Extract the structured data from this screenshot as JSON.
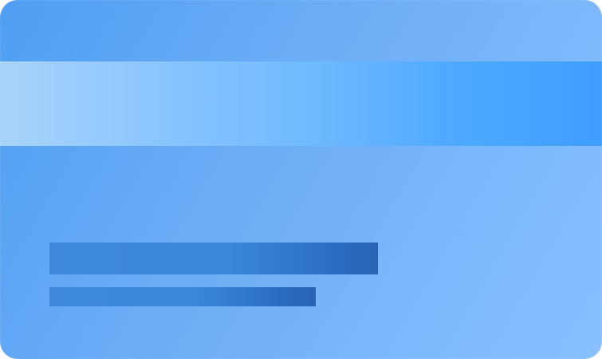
{
  "card": {
    "colors": {
      "card_gradient_start": "#4f9ef3",
      "card_gradient_mid": "#6eaef6",
      "card_gradient_end": "#88c0ff",
      "stripe_gradient_start": "#a9d4fb",
      "stripe_gradient_end": "#3e9eff",
      "placeholder_gradient_start": "#3f88d9",
      "placeholder_gradient_end": "#2763b2"
    }
  }
}
